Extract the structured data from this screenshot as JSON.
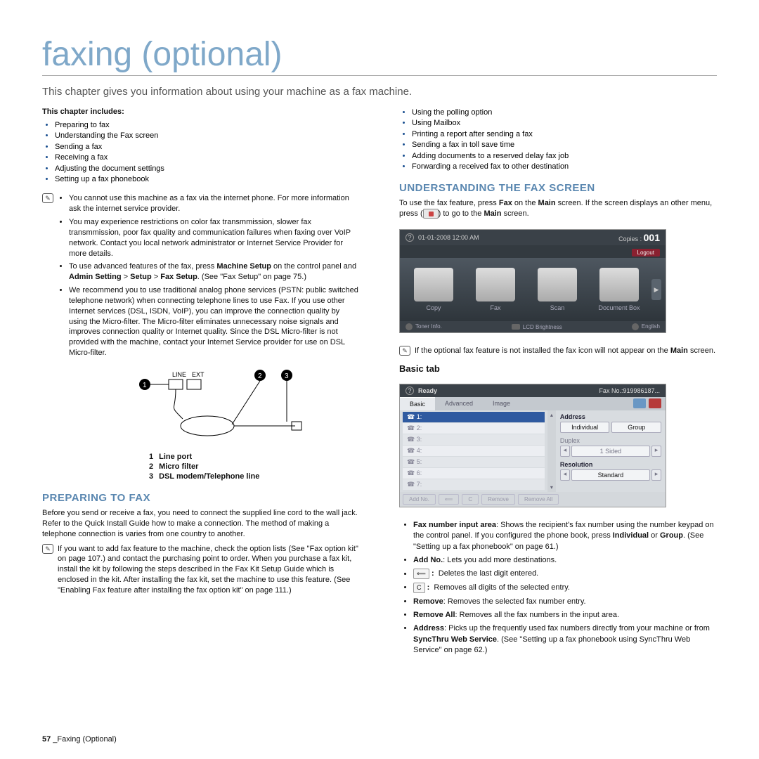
{
  "title": "faxing (optional)",
  "subtitle": "This chapter gives you information about using your machine as a fax machine.",
  "chapter_includes_label": "This chapter includes:",
  "toc_left": [
    "Preparing to fax",
    "Understanding the Fax screen",
    "Sending a fax",
    "Receiving a fax",
    "Adjusting the document settings",
    "Setting up a fax phonebook"
  ],
  "toc_right": [
    "Using the polling option",
    "Using Mailbox",
    "Printing a report after sending a fax",
    "Sending a fax in toll save time",
    "Adding documents to a reserved delay fax job",
    "Forwarding a received fax to other destination"
  ],
  "notes1": {
    "b1": "You cannot use this machine as a fax via the internet phone. For more information ask the internet service provider.",
    "b2": "You may experience restrictions on color fax transmmission, slower fax transmmission, poor fax quality and communication failures when faxing over VoIP network. Contact you local network administrator or Internet Service Provider for more details.",
    "b3a": "To use advanced features of the fax, press ",
    "b3b": "Machine Setup",
    "b3c": " on the control panel and ",
    "b3d": "Admin Setting",
    "b3e": " > ",
    "b3f": "Setup",
    "b3g": " > ",
    "b3h": "Fax Setup",
    "b3i": ". (See \"Fax Setup\" on page 75.)",
    "b4": "We recommend you to use traditional analog phone services (PSTN: public switched telephone network) when connecting telephone lines to use Fax. If you use other Internet services (DSL, ISDN, VoIP), you can improve the connection quality by using the Micro-filter. The Micro-filter eliminates unnecessary noise signals and improves connection quality or Internet quality. Since the DSL Micro-filter is not provided with the machine, contact your Internet Service provider for use on DSL Micro-filter."
  },
  "diagram_labels": {
    "line": "LINE",
    "ext": "EXT",
    "l1": "Line port",
    "l2": "Micro filter",
    "l3": "DSL modem/Telephone line"
  },
  "section_prepare": "PREPARING TO FAX",
  "prepare_body": "Before you send or receive a fax, you need to connect the supplied line cord to the wall jack. Refer to the Quick Install Guide how to make a connection. The method of making a telephone connection is varies from one country to another.",
  "note_prepare": "If you want to add fax feature to the machine, check the option lists (See \"Fax option kit\" on page 107.) and contact the purchasing point to order. When you purchase a fax kit, install the kit by following the steps described in the Fax Kit Setup Guide which is enclosed in the kit. After installing the fax kit, set the machine to use this feature. (See \"Enabling Fax feature after installing the fax option kit\" on page 111.)",
  "section_understand": "UNDERSTANDING THE FAX SCREEN",
  "understand_body_a": "To use the fax feature, press ",
  "understand_body_b": "Fax",
  "understand_body_c": " on the ",
  "understand_body_d": "Main",
  "understand_body_e": " screen. If the screen displays an other menu, press (",
  "understand_body_f": ") to go to the ",
  "understand_body_g": "Main",
  "understand_body_h": " screen.",
  "note_understand_a": "If the optional fax feature is not installed the fax icon will not appear on the ",
  "note_understand_b": "Main",
  "note_understand_c": " screen.",
  "basic_tab": "Basic tab",
  "main_screen": {
    "date": "01-01-2008 12:00 AM",
    "copies_label": "Copies :",
    "copies_value": "001",
    "logout": "Logout",
    "items": [
      "Copy",
      "Fax",
      "Scan",
      "Document Box"
    ],
    "tonerinfo": "Toner Info.",
    "lcd": "LCD Brightness",
    "lang": "English"
  },
  "basic_screen": {
    "ready": "Ready",
    "faxno": "Fax No.:919986187...",
    "tabs": [
      "Basic",
      "Advanced",
      "Image"
    ],
    "address": "Address",
    "individual": "Individual",
    "group": "Group",
    "duplex": "Duplex",
    "sided": "1 Sided",
    "resolution": "Resolution",
    "standard": "Standard",
    "addno": "Add No.",
    "remove": "Remove",
    "removeall": "Remove All"
  },
  "desc": {
    "d1a": "Fax number input area",
    "d1b": ": Shows the recipient's fax number using the number keypad on the control panel. If you configured the phone book, press ",
    "d1c": "Individual",
    "d1d": " or ",
    "d1e": "Group",
    "d1f": ". (See \"Setting up a fax phonebook\" on page 61.)",
    "d2a": "Add No.",
    "d2b": ": Lets you add more destinations.",
    "d3": "Deletes the last digit entered.",
    "d4": "Removes all digits of the selected entry.",
    "d5a": "Remove",
    "d5b": ": Removes the selected fax number entry.",
    "d6a": "Remove All",
    "d6b": ": Removes all the fax numbers in the input area.",
    "d7a": "Address",
    "d7b": ": Picks up the frequently used fax numbers directly from your machine or from ",
    "d7c": "SyncThru Web Service",
    "d7d": ". (See \"Setting up a fax phonebook using SyncThru Web Service\" on page 62.)"
  },
  "footer_page": "57",
  "footer_text": " _Faxing (Optional)"
}
